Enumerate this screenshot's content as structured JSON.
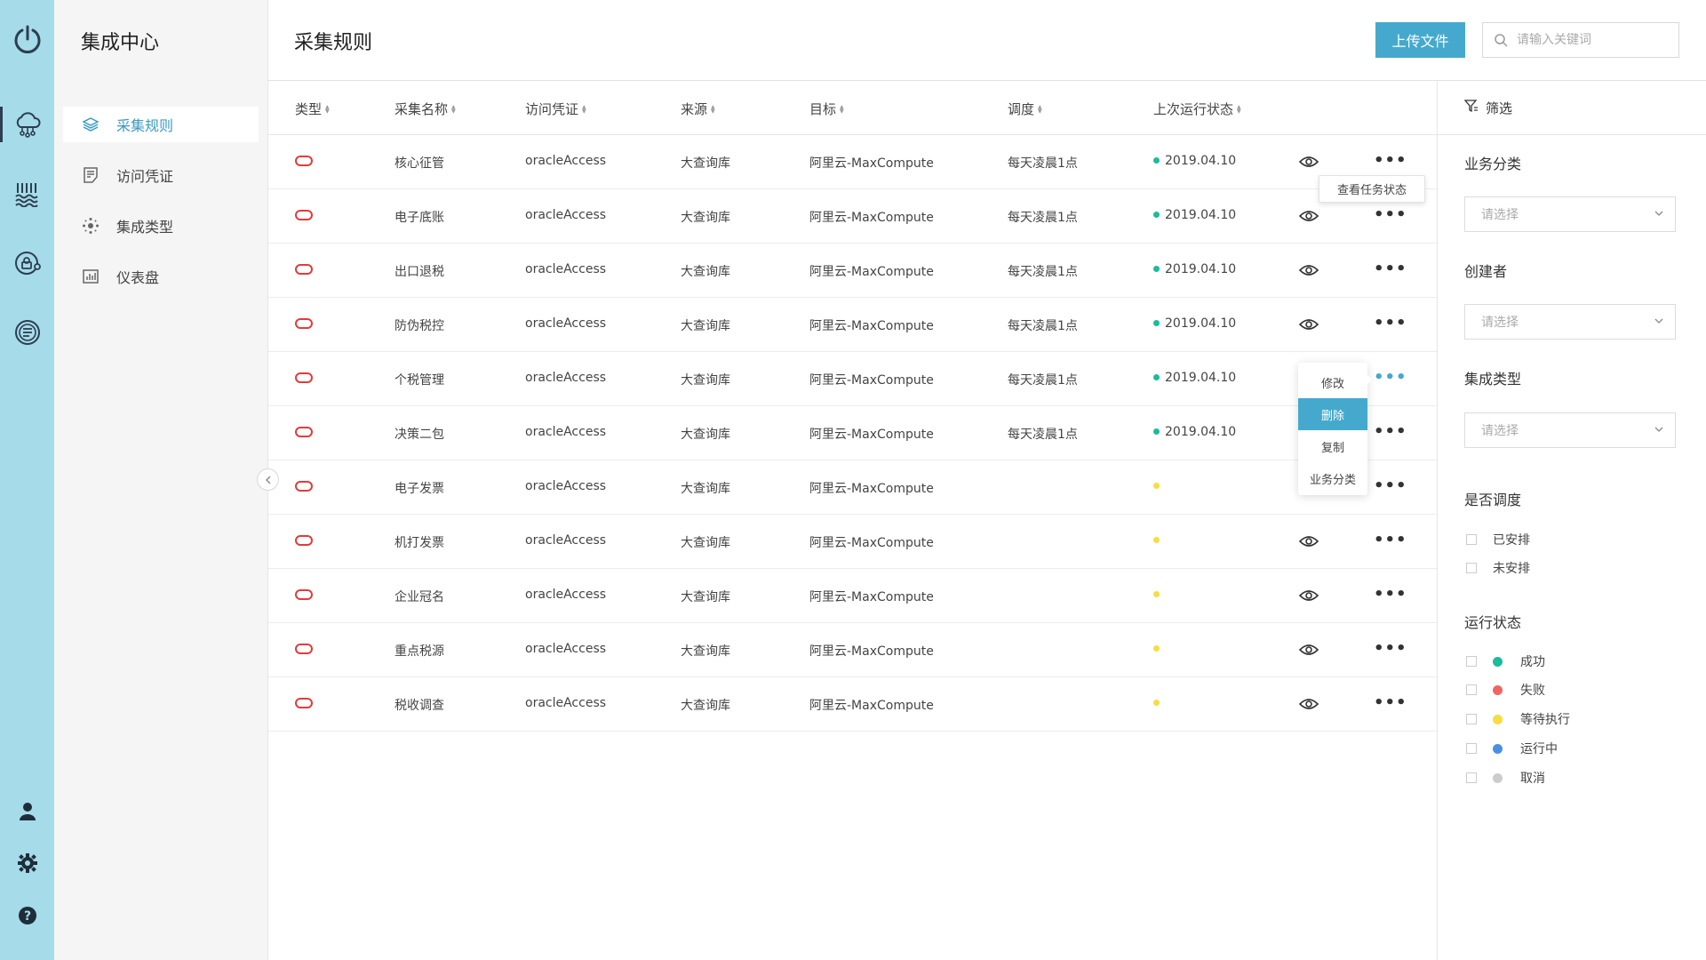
{
  "app": {
    "brand": "集成中心"
  },
  "nav": [
    {
      "label": "采集规则",
      "icon": "layers-icon"
    },
    {
      "label": "访问凭证",
      "icon": "document-icon"
    },
    {
      "label": "集成类型",
      "icon": "hub-icon"
    },
    {
      "label": "仪表盘",
      "icon": "bar-chart-icon"
    }
  ],
  "header": {
    "title": "采集规则",
    "upload_label": "上传文件",
    "search_placeholder": "请输入关键词"
  },
  "table": {
    "columns": [
      "类型",
      "采集名称",
      "访问凭证",
      "来源",
      "目标",
      "调度",
      "上次运行状态"
    ],
    "rows": [
      {
        "name": "核心征管",
        "credential": "oracleAccess",
        "source": "大查询库",
        "target": "阿里云-MaxCompute",
        "schedule": "每天凌晨1点",
        "status_date": "2019.04.10",
        "status": "success"
      },
      {
        "name": "电子底账",
        "credential": "oracleAccess",
        "source": "大查询库",
        "target": "阿里云-MaxCompute",
        "schedule": "每天凌晨1点",
        "status_date": "2019.04.10",
        "status": "success"
      },
      {
        "name": "出口退税",
        "credential": "oracleAccess",
        "source": "大查询库",
        "target": "阿里云-MaxCompute",
        "schedule": "每天凌晨1点",
        "status_date": "2019.04.10",
        "status": "success"
      },
      {
        "name": "防伪税控",
        "credential": "oracleAccess",
        "source": "大查询库",
        "target": "阿里云-MaxCompute",
        "schedule": "每天凌晨1点",
        "status_date": "2019.04.10",
        "status": "success"
      },
      {
        "name": "个税管理",
        "credential": "oracleAccess",
        "source": "大查询库",
        "target": "阿里云-MaxCompute",
        "schedule": "每天凌晨1点",
        "status_date": "2019.04.10",
        "status": "success"
      },
      {
        "name": "决策二包",
        "credential": "oracleAccess",
        "source": "大查询库",
        "target": "阿里云-MaxCompute",
        "schedule": "每天凌晨1点",
        "status_date": "2019.04.10",
        "status": "success"
      },
      {
        "name": "电子发票",
        "credential": "oracleAccess",
        "source": "大查询库",
        "target": "阿里云-MaxCompute",
        "schedule": "",
        "status_date": "",
        "status": "waiting"
      },
      {
        "name": "机打发票",
        "credential": "oracleAccess",
        "source": "大查询库",
        "target": "阿里云-MaxCompute",
        "schedule": "",
        "status_date": "",
        "status": "waiting"
      },
      {
        "name": "企业冠名",
        "credential": "oracleAccess",
        "source": "大查询库",
        "target": "阿里云-MaxCompute",
        "schedule": "",
        "status_date": "",
        "status": "waiting"
      },
      {
        "name": "重点税源",
        "credential": "oracleAccess",
        "source": "大查询库",
        "target": "阿里云-MaxCompute",
        "schedule": "",
        "status_date": "",
        "status": "waiting"
      },
      {
        "name": "税收调查",
        "credential": "oracleAccess",
        "source": "大查询库",
        "target": "阿里云-MaxCompute",
        "schedule": "",
        "status_date": "",
        "status": "waiting"
      }
    ]
  },
  "tooltip": {
    "text": "查看任务状态"
  },
  "row_menu": {
    "items": [
      "修改",
      "删除",
      "复制",
      "业务分类"
    ],
    "highlighted": "删除"
  },
  "filter": {
    "title": "筛选",
    "business_category": {
      "label": "业务分类",
      "placeholder": "请选择"
    },
    "creator": {
      "label": "创建者",
      "placeholder": "请选择"
    },
    "integration_type": {
      "label": "集成类型",
      "placeholder": "请选择"
    },
    "scheduled": {
      "label": "是否调度",
      "options": [
        "已安排",
        "未安排"
      ]
    },
    "run_status": {
      "label": "运行状态",
      "options": [
        {
          "label": "成功",
          "color": "#1abc9c"
        },
        {
          "label": "失败",
          "color": "#f06464"
        },
        {
          "label": "等待执行",
          "color": "#f7dd3f"
        },
        {
          "label": "运行中",
          "color": "#4a90e2"
        },
        {
          "label": "取消",
          "color": "#cccccc"
        }
      ]
    }
  },
  "colors": {
    "accent": "#45a9cd",
    "rail": "#a6dbe9",
    "oracle_red": "#e23b3b",
    "success": "#1abc9c",
    "waiting": "#f7dd3f"
  }
}
